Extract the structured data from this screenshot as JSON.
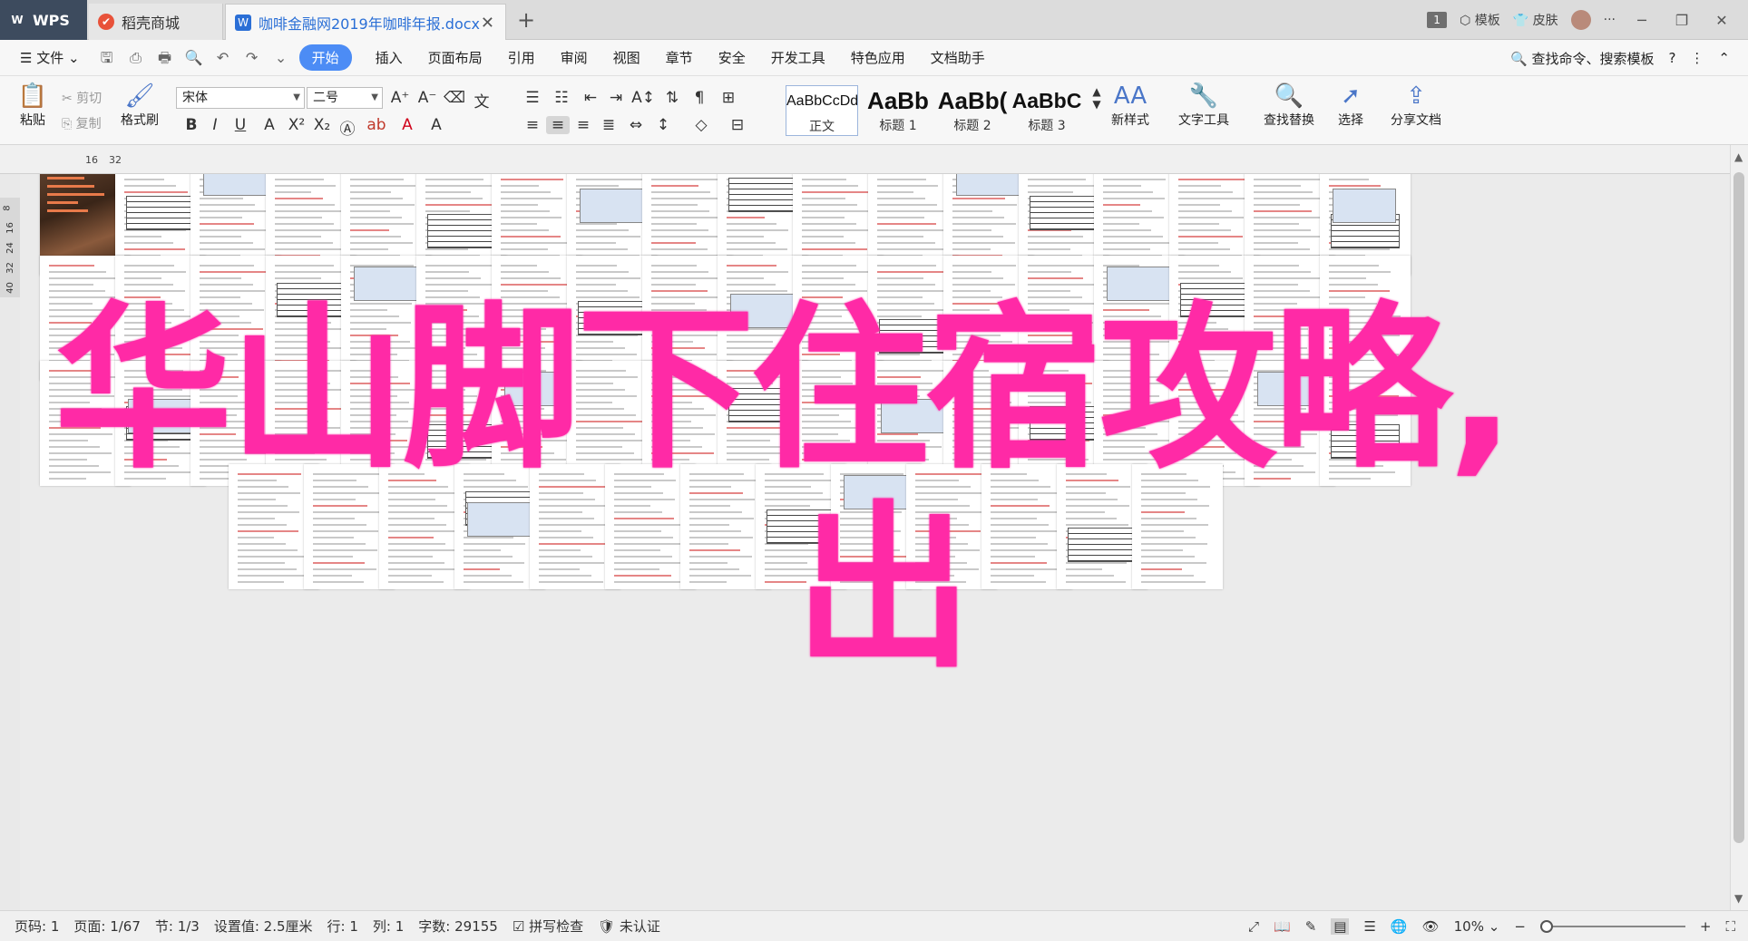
{
  "tabs": {
    "wps": "WPS",
    "daoke": "稻壳商城",
    "doc": "咖啡金融网2019年咖啡年报.docx"
  },
  "window": {
    "badge": "1",
    "template": "模板",
    "skin": "皮肤"
  },
  "menu": {
    "file": "文件",
    "items": [
      "开始",
      "插入",
      "页面布局",
      "引用",
      "审阅",
      "视图",
      "章节",
      "安全",
      "开发工具",
      "特色应用",
      "文档助手"
    ],
    "search": "查找命令、搜索模板"
  },
  "ribbon": {
    "paste": "粘贴",
    "cut": "剪切",
    "copy": "复制",
    "format_painter": "格式刷",
    "font_name": "宋体",
    "font_size": "二号",
    "styles": [
      {
        "sample": "AaBbCcDd",
        "label": "正文"
      },
      {
        "sample": "AaBb",
        "label": "标题 1"
      },
      {
        "sample": "AaBb(",
        "label": "标题 2"
      },
      {
        "sample": "AaBbC",
        "label": "标题 3"
      }
    ],
    "new_style": "新样式",
    "text_tools": "文字工具",
    "find_replace": "查找替换",
    "select": "选择",
    "share": "分享文档"
  },
  "ruler": {
    "h1": "16",
    "h2": "32",
    "v": [
      "8",
      "16",
      "24",
      "32",
      "40"
    ]
  },
  "overlay": {
    "line1": "华山脚下住宿攻略,",
    "line2": "出"
  },
  "status": {
    "page_no": "页码: 1",
    "page": "页面: 1/67",
    "section": "节: 1/3",
    "setting": "设置值: 2.5厘米",
    "row": "行: 1",
    "col": "列: 1",
    "words": "字数: 29155",
    "spell": "拼写检查",
    "auth": "未认证",
    "zoom": "10%",
    "zoom_level": 0.0
  },
  "colors": {
    "accent": "#4c8cf5",
    "overlay": "#ff2aa6",
    "wps_tab": "#3d4b5e"
  }
}
